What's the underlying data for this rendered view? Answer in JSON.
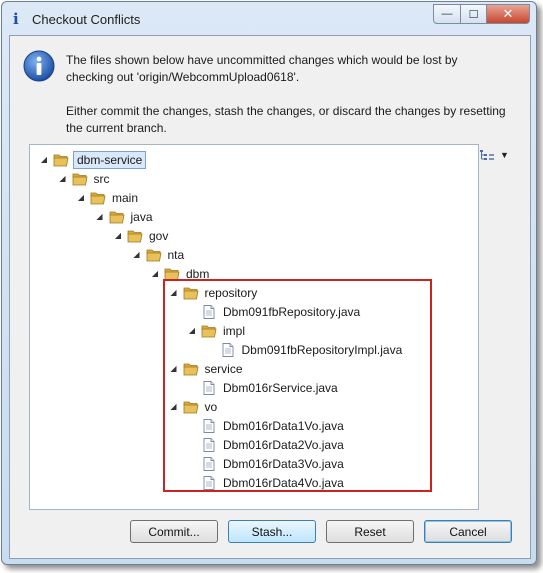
{
  "window": {
    "title": "Checkout Conflicts"
  },
  "message": {
    "line1": "The files shown below have uncommitted changes which would be lost by checking out 'origin/WebcommUpload0618'.",
    "line2": "Either commit the changes, stash the changes, or discard the changes by resetting the current branch."
  },
  "tree": [
    {
      "label": "dbm-service",
      "type": "folder",
      "depth": 0,
      "selected": true
    },
    {
      "label": "src",
      "type": "folder",
      "depth": 1
    },
    {
      "label": "main",
      "type": "folder",
      "depth": 2
    },
    {
      "label": "java",
      "type": "folder",
      "depth": 3
    },
    {
      "label": "gov",
      "type": "folder",
      "depth": 4
    },
    {
      "label": "nta",
      "type": "folder",
      "depth": 5
    },
    {
      "label": "dbm",
      "type": "folder",
      "depth": 6
    },
    {
      "label": "repository",
      "type": "folder",
      "depth": 7
    },
    {
      "label": "Dbm091fbRepository.java",
      "type": "file",
      "depth": 8
    },
    {
      "label": "impl",
      "type": "folder",
      "depth": 8
    },
    {
      "label": "Dbm091fbRepositoryImpl.java",
      "type": "file",
      "depth": 9
    },
    {
      "label": "service",
      "type": "folder",
      "depth": 7
    },
    {
      "label": "Dbm016rService.java",
      "type": "file",
      "depth": 8
    },
    {
      "label": "vo",
      "type": "folder",
      "depth": 7
    },
    {
      "label": "Dbm016rData1Vo.java",
      "type": "file",
      "depth": 8
    },
    {
      "label": "Dbm016rData2Vo.java",
      "type": "file",
      "depth": 8
    },
    {
      "label": "Dbm016rData3Vo.java",
      "type": "file",
      "depth": 8
    },
    {
      "label": "Dbm016rData4Vo.java",
      "type": "file",
      "depth": 8
    }
  ],
  "buttons": {
    "commit": "Commit...",
    "stash": "Stash...",
    "reset": "Reset",
    "cancel": "Cancel"
  },
  "colors": {
    "highlight_border": "#cc2222",
    "folder": "#e8c15a"
  }
}
